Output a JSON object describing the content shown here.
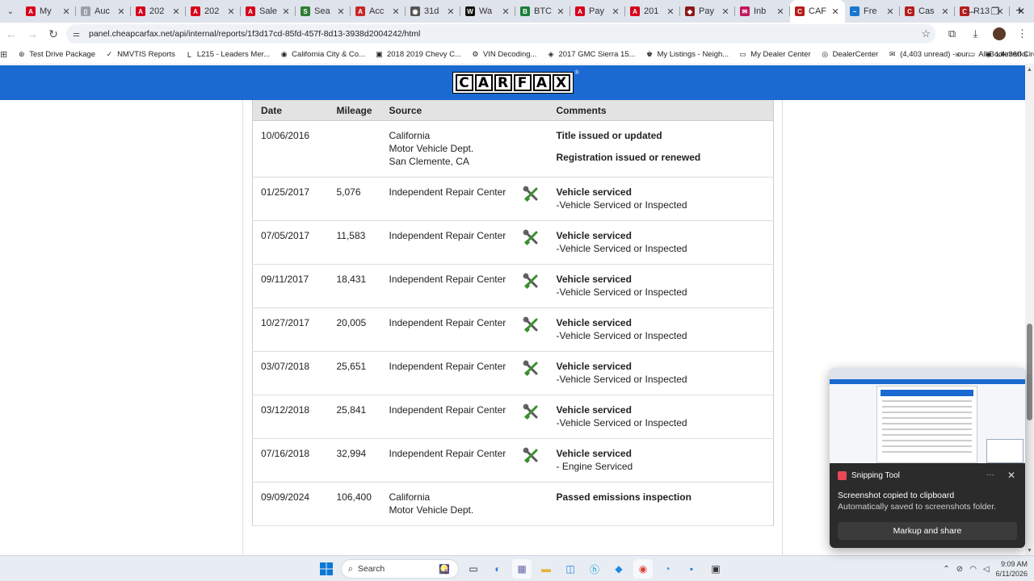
{
  "browser": {
    "tabs": [
      {
        "label": "My",
        "fav_color": "#d6001c",
        "fav_glyph": "A"
      },
      {
        "label": "Auc",
        "fav_color": "#9aa0a6",
        "fav_glyph": "▯"
      },
      {
        "label": "202",
        "fav_color": "#d6001c",
        "fav_glyph": "A"
      },
      {
        "label": "202",
        "fav_color": "#d6001c",
        "fav_glyph": "A"
      },
      {
        "label": "Sale",
        "fav_color": "#d6001c",
        "fav_glyph": "A"
      },
      {
        "label": "Sea",
        "fav_color": "#2e7d32",
        "fav_glyph": "S"
      },
      {
        "label": "Acc",
        "fav_color": "#c62828",
        "fav_glyph": "A"
      },
      {
        "label": "31d",
        "fav_color": "#555555",
        "fav_glyph": "◉"
      },
      {
        "label": "Wa",
        "fav_color": "#111111",
        "fav_glyph": "W"
      },
      {
        "label": "BTC",
        "fav_color": "#1b7f3a",
        "fav_glyph": "B"
      },
      {
        "label": "Pay",
        "fav_color": "#d6001c",
        "fav_glyph": "A"
      },
      {
        "label": "201",
        "fav_color": "#d6001c",
        "fav_glyph": "A"
      },
      {
        "label": "Pay",
        "fav_color": "#8b1a1a",
        "fav_glyph": "◆"
      },
      {
        "label": "Inb",
        "fav_color": "#c2185b",
        "fav_glyph": "✉"
      },
      {
        "label": "CAF",
        "fav_color": "#b71c1c",
        "fav_glyph": "C",
        "active": true
      },
      {
        "label": "Fre",
        "fav_color": "#1976d2",
        "fav_glyph": "~"
      },
      {
        "label": "Cas",
        "fav_color": "#b71c1c",
        "fav_glyph": "C"
      },
      {
        "label": "R13",
        "fav_color": "#b71c1c",
        "fav_glyph": "C"
      }
    ],
    "new_tab": "+",
    "url": "panel.cheapcarfax.net/api/internal/reports/1f3d17cd-85fd-457f-8d13-3938d2004242/html",
    "bookmarks": [
      {
        "label": "Test Drive Package",
        "icon": "⊛"
      },
      {
        "label": "NMVTIS Reports",
        "icon": "✓"
      },
      {
        "label": "L215 - Leaders Mer...",
        "icon": "L"
      },
      {
        "label": "California City & Co...",
        "icon": "◉"
      },
      {
        "label": "2018 2019 Chevy C...",
        "icon": "▣"
      },
      {
        "label": "VIN Decoding...",
        "icon": "⚙"
      },
      {
        "label": "2017 GMC Sierra 15...",
        "icon": "◈"
      },
      {
        "label": "My Listings - Neigh...",
        "icon": "♚"
      },
      {
        "label": "My Dealer Center",
        "icon": "▭"
      },
      {
        "label": "DealerCenter",
        "icon": "◎"
      },
      {
        "label": "(4,403 unread) - our...",
        "icon": "✉"
      },
      {
        "label": "Life360 Circles",
        "icon": "◉"
      }
    ],
    "all_bookmarks": "All Bookmarks"
  },
  "carfax": {
    "logo_letters": [
      "C",
      "A",
      "R",
      "F",
      "A",
      "X"
    ],
    "brand_color": "#1a6ad1"
  },
  "history": {
    "headers": {
      "date": "Date",
      "mileage": "Mileage",
      "source": "Source",
      "comments": "Comments"
    },
    "rows": [
      {
        "date": "10/06/2016",
        "mileage": "",
        "source": [
          "California",
          "Motor Vehicle Dept.",
          "San Clemente, CA"
        ],
        "service_icon": false,
        "comments": [
          {
            "text": "Title issued or updated",
            "bold": true
          },
          {
            "text": "Registration issued or renewed",
            "bold": true,
            "gap": true
          }
        ]
      },
      {
        "date": "01/25/2017",
        "mileage": "5,076",
        "source": [
          "Independent Repair Center"
        ],
        "service_icon": true,
        "comments": [
          {
            "text": "Vehicle serviced",
            "bold": true
          },
          {
            "text": "-Vehicle Serviced or Inspected",
            "bold": false
          }
        ]
      },
      {
        "date": "07/05/2017",
        "mileage": "11,583",
        "source": [
          "Independent Repair Center"
        ],
        "service_icon": true,
        "comments": [
          {
            "text": "Vehicle serviced",
            "bold": true
          },
          {
            "text": "-Vehicle Serviced or Inspected",
            "bold": false
          }
        ]
      },
      {
        "date": "09/11/2017",
        "mileage": "18,431",
        "source": [
          "Independent Repair Center"
        ],
        "service_icon": true,
        "comments": [
          {
            "text": "Vehicle serviced",
            "bold": true
          },
          {
            "text": "-Vehicle Serviced or Inspected",
            "bold": false
          }
        ]
      },
      {
        "date": "10/27/2017",
        "mileage": "20,005",
        "source": [
          "Independent Repair Center"
        ],
        "service_icon": true,
        "comments": [
          {
            "text": "Vehicle serviced",
            "bold": true
          },
          {
            "text": "-Vehicle Serviced or Inspected",
            "bold": false
          }
        ]
      },
      {
        "date": "03/07/2018",
        "mileage": "25,651",
        "source": [
          "Independent Repair Center"
        ],
        "service_icon": true,
        "comments": [
          {
            "text": "Vehicle serviced",
            "bold": true
          },
          {
            "text": "-Vehicle Serviced or Inspected",
            "bold": false
          }
        ]
      },
      {
        "date": "03/12/2018",
        "mileage": "25,841",
        "source": [
          "Independent Repair Center"
        ],
        "service_icon": true,
        "comments": [
          {
            "text": "Vehicle serviced",
            "bold": true
          },
          {
            "text": "-Vehicle Serviced or Inspected",
            "bold": false
          }
        ]
      },
      {
        "date": "07/16/2018",
        "mileage": "32,994",
        "source": [
          "Independent Repair Center"
        ],
        "service_icon": true,
        "comments": [
          {
            "text": "Vehicle serviced",
            "bold": true
          },
          {
            "text": "- Engine Serviced",
            "bold": false
          }
        ]
      },
      {
        "date": "09/09/2024",
        "mileage": "106,400",
        "source": [
          "California",
          "Motor Vehicle Dept."
        ],
        "service_icon": false,
        "comments": [
          {
            "text": "Passed emissions inspection",
            "bold": true
          }
        ]
      }
    ]
  },
  "snipping_tool": {
    "app_name": "Snipping Tool",
    "more": "···",
    "title": "Screenshot copied to clipboard",
    "subtitle": "Automatically saved to screenshots folder.",
    "button": "Markup and share"
  },
  "taskbar": {
    "search_label": "Search",
    "time": "9:09 AM",
    "date": "6/11/2026"
  }
}
